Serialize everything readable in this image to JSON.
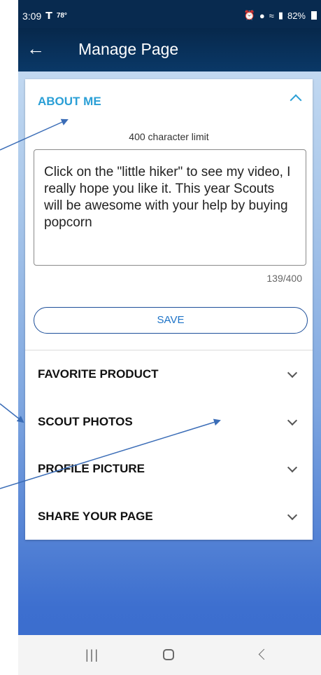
{
  "status_bar": {
    "time": "3:09",
    "temp": "78°",
    "battery": "82%"
  },
  "app_bar": {
    "back_icon": "←",
    "title": "Manage Page"
  },
  "about_me": {
    "heading": "ABOUT ME",
    "char_limit": "400 character limit",
    "text": "Click on the \"little hiker\" to see my video, I really hope you like it. This year Scouts will be awesome with your help by buying popcorn",
    "counter": "139/400",
    "save_label": "SAVE"
  },
  "sections": [
    {
      "label": "FAVORITE PRODUCT"
    },
    {
      "label": "SCOUT PHOTOS"
    },
    {
      "label": "PROFILE PICTURE"
    },
    {
      "label": "SHARE YOUR PAGE"
    }
  ],
  "nav": {
    "recent_icon": "|||"
  },
  "colors": {
    "accent": "#2a9fd6",
    "app_bar": "#082a4f",
    "annotation_arrow": "#3b6db7"
  }
}
